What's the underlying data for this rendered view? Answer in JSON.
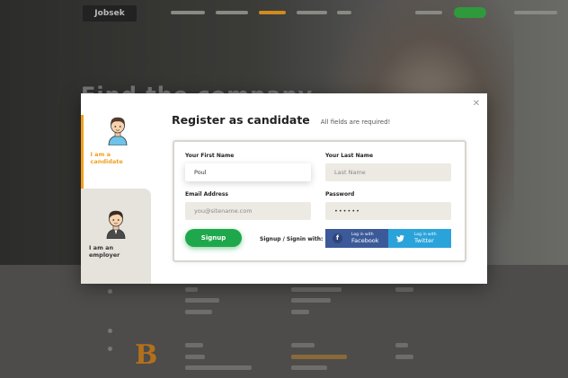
{
  "background": {
    "logo": "Jobsek",
    "hero_title": "Find the company",
    "section_letter": "B"
  },
  "modal": {
    "title": "Register as candidate",
    "subtitle": "All fields are required!",
    "close_icon": "close-icon",
    "tabs": [
      {
        "label": "I am a candidate",
        "icon": "candidate-avatar-icon",
        "active": true,
        "color": "#f0a020"
      },
      {
        "label": "I am an employer",
        "icon": "employer-avatar-icon",
        "active": false,
        "color": "#333333"
      }
    ],
    "form": {
      "first_name": {
        "label": "Your First Name",
        "value": "Poul",
        "placeholder": ""
      },
      "last_name": {
        "label": "Your Last Name",
        "value": "",
        "placeholder": "Last Name"
      },
      "email": {
        "label": "Email Address",
        "value": "",
        "placeholder": "you@sitename.com"
      },
      "password": {
        "label": "Password",
        "value": "••••••",
        "placeholder": ""
      },
      "signup_button": "Signup",
      "signin_with": "Signup / Signin with:",
      "facebook": {
        "small": "Log in with",
        "big": "Facebook",
        "icon": "facebook-icon",
        "color": "#3c5a99"
      },
      "twitter": {
        "small": "Log in with",
        "big": "Twitter",
        "icon": "twitter-icon",
        "color": "#2aa3db"
      }
    },
    "accent_color": "#f0a020",
    "signup_color": "#1ea84b"
  }
}
